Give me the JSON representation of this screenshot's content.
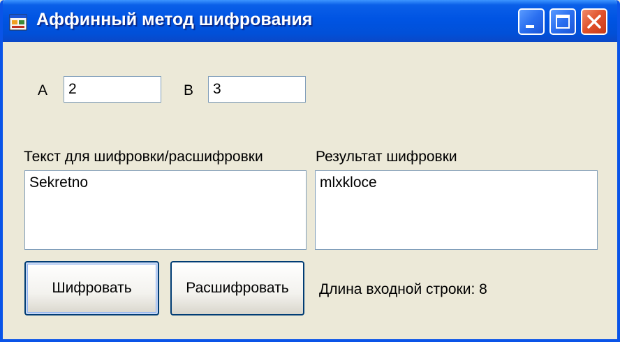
{
  "window": {
    "title": "Аффинный метод шифрования"
  },
  "params": {
    "a_label": "A",
    "a_value": "2",
    "b_label": "B",
    "b_value": "3"
  },
  "input": {
    "label": "Текст для шифровки/расшифровки",
    "value": "Sekretno"
  },
  "output": {
    "label": "Результат шифровки",
    "value": "mlxkloce"
  },
  "actions": {
    "encrypt_label": "Шифровать",
    "decrypt_label": "Расшифровать"
  },
  "status": {
    "length_text": "Длина входной строки: 8"
  },
  "icons": {
    "app": "app-window-icon",
    "minimize": "minimize-icon",
    "maximize": "maximize-icon",
    "close": "close-icon"
  },
  "colors": {
    "titlebar": "#0054e3",
    "window_bg": "#ece9d8",
    "close_button": "#e0502a"
  }
}
